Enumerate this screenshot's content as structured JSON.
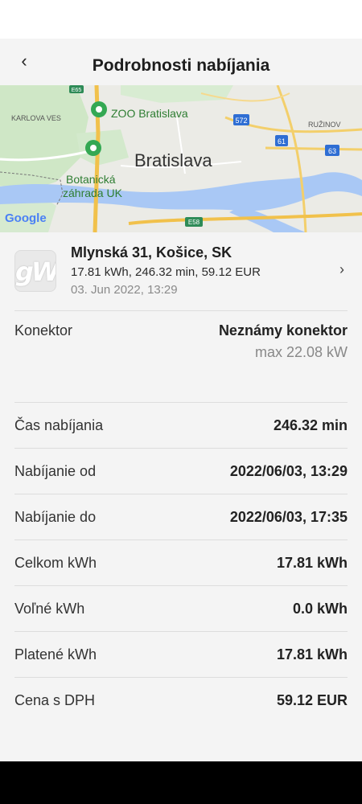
{
  "header": {
    "title": "Podrobnosti nabíjania",
    "back_icon": "arrow-left-icon"
  },
  "map": {
    "city": "Bratislava",
    "labels": {
      "karlova_ves": "KARLOVA VES",
      "zoo": "ZOO Bratislava",
      "ruzinov": "RUŽINOV",
      "botanicka_1": "Botanická",
      "botanicka_2": "záhrada UK",
      "google": "Google"
    },
    "shields": {
      "e65": "E65",
      "r572": "572",
      "r61": "61",
      "r63": "63",
      "e58": "E58"
    }
  },
  "station": {
    "name": "Mlynská 31, Košice, SK",
    "summary": "17.81 kWh, 246.32 min, 59.12 EUR",
    "date": "03. Jun 2022, 13:29",
    "chevron_icon": "chevron-right-icon"
  },
  "connector": {
    "label": "Konektor",
    "value": "Neznámy konektor",
    "max": "max 22.08 kW"
  },
  "details": [
    {
      "label": "Čas nabíjania",
      "value": "246.32 min"
    },
    {
      "label": "Nabíjanie od",
      "value": "2022/06/03, 13:29"
    },
    {
      "label": "Nabíjanie do",
      "value": "2022/06/03, 17:35"
    },
    {
      "label": "Celkom kWh",
      "value": "17.81 kWh"
    },
    {
      "label": "Voľné kWh",
      "value": "0.0 kWh"
    },
    {
      "label": "Platené kWh",
      "value": "17.81 kWh"
    },
    {
      "label": "Cena s DPH",
      "value": "59.12 EUR"
    }
  ]
}
